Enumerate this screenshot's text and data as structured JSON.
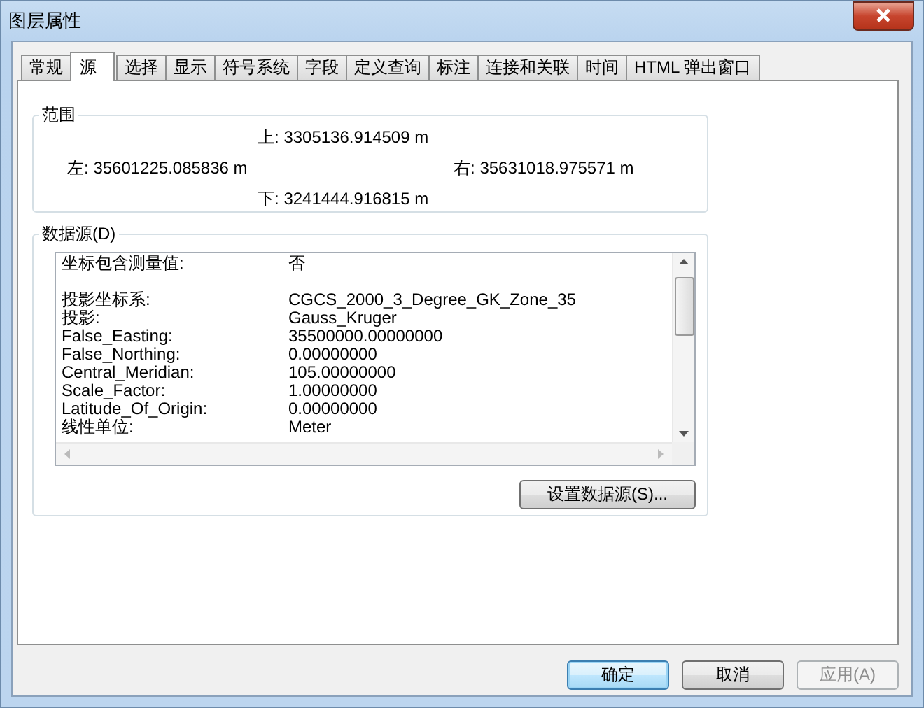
{
  "window": {
    "title": "图层属性"
  },
  "tabs": [
    {
      "label": "常规",
      "selected": false
    },
    {
      "label": "源",
      "selected": true
    },
    {
      "label": "选择",
      "selected": false
    },
    {
      "label": "显示",
      "selected": false
    },
    {
      "label": "符号系统",
      "selected": false
    },
    {
      "label": "字段",
      "selected": false
    },
    {
      "label": "定义查询",
      "selected": false
    },
    {
      "label": "标注",
      "selected": false
    },
    {
      "label": "连接和关联",
      "selected": false
    },
    {
      "label": "时间",
      "selected": false
    },
    {
      "label": "HTML 弹出窗口",
      "selected": false
    }
  ],
  "extent": {
    "title": "范围",
    "top": {
      "label": "上:",
      "value": "3305136.914509 m"
    },
    "left": {
      "label": "左:",
      "value": "35601225.085836 m"
    },
    "right": {
      "label": "右:",
      "value": "35631018.975571 m"
    },
    "bottom": {
      "label": "下:",
      "value": "3241444.916815 m"
    }
  },
  "data_source": {
    "title": "数据源(D)",
    "sections": [
      [
        {
          "key": "坐标包含测量值:",
          "value": "否"
        }
      ],
      [
        {
          "key": "投影坐标系:",
          "value": "CGCS_2000_3_Degree_GK_Zone_35"
        },
        {
          "key": "投影:",
          "value": "Gauss_Kruger"
        },
        {
          "key": "False_Easting:",
          "value": "35500000.00000000"
        },
        {
          "key": "False_Northing:",
          "value": "0.00000000"
        },
        {
          "key": "Central_Meridian:",
          "value": "105.00000000"
        },
        {
          "key": "Scale_Factor:",
          "value": "1.00000000"
        },
        {
          "key": "Latitude_Of_Origin:",
          "value": "0.00000000"
        },
        {
          "key": "线性单位:",
          "value": "Meter"
        }
      ]
    ],
    "button": "设置数据源(S)..."
  },
  "buttons": [
    {
      "label": "确定",
      "kind": "default",
      "disabled": false
    },
    {
      "label": "取消",
      "kind": "normal",
      "disabled": false
    },
    {
      "label": "应用(A)",
      "kind": "normal",
      "disabled": true
    }
  ]
}
